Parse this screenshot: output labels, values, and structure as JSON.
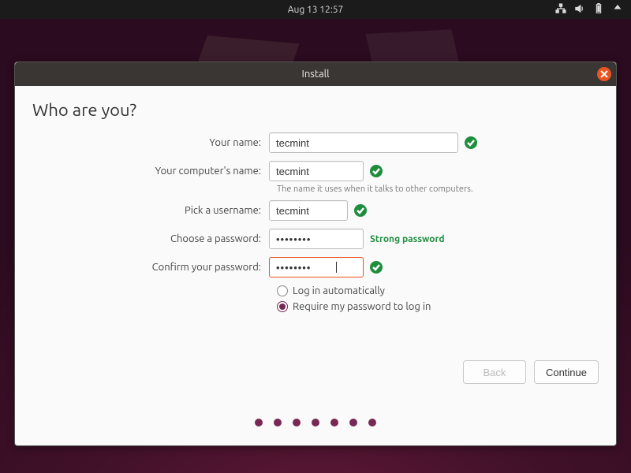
{
  "topbar": {
    "datetime": "Aug 13  12:57"
  },
  "window": {
    "title": "Install",
    "heading": "Who are you?",
    "labels": {
      "your_name": "Your name:",
      "computer_name": "Your computer's name:",
      "computer_hint": "The name it uses when it talks to other computers.",
      "username": "Pick a username:",
      "password": "Choose a password:",
      "confirm": "Confirm your password:",
      "login_auto": "Log in automatically",
      "login_req": "Require my password to log in"
    },
    "values": {
      "your_name": "tecmint",
      "computer_name": "tecmint",
      "username": "tecmint",
      "password": "••••••••",
      "confirm": "••••••••",
      "strength": "Strong password"
    },
    "buttons": {
      "back": "Back",
      "continue": "Continue"
    }
  }
}
